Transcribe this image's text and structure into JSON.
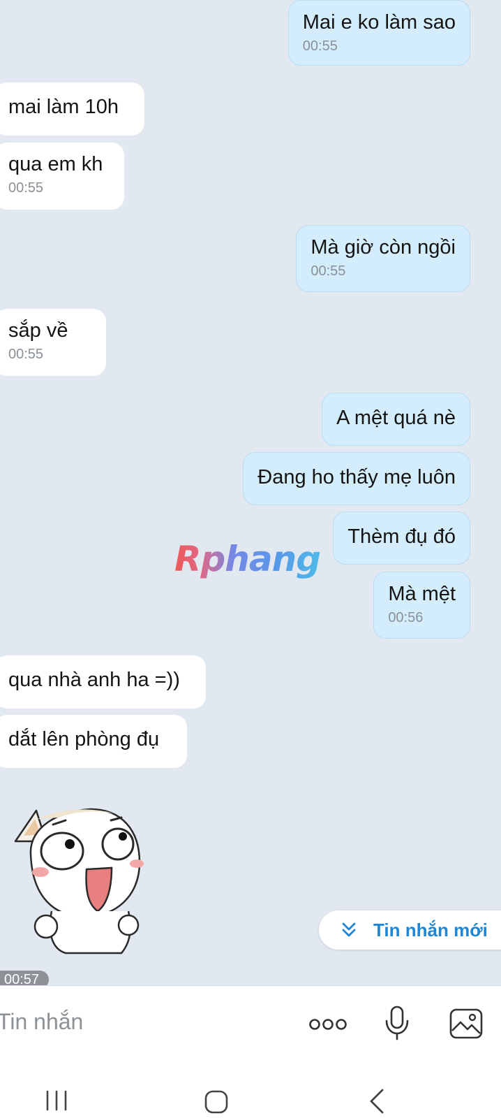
{
  "messages": [
    {
      "text": "Mai e ko làm sao",
      "time": "00:55"
    },
    {
      "text": "mai làm 10h"
    },
    {
      "text": "qua em kh",
      "time": "00:55"
    },
    {
      "text": "Mà giờ còn ngồi",
      "time": "00:55"
    },
    {
      "text": "sắp về",
      "time": "00:55"
    },
    {
      "text": "A mệt quá nè"
    },
    {
      "text": "Đang ho thấy mẹ luôn"
    },
    {
      "text": "Thèm đụ đó"
    },
    {
      "text": "Mà mệt",
      "time": "00:56"
    },
    {
      "text": "qua nhà anh ha =))"
    },
    {
      "text": "dắt lên phòng đụ"
    }
  ],
  "sticker": {
    "time": "00:57"
  },
  "watermark": "Rphang",
  "new_message_button": {
    "label": "Tin nhắn mới"
  },
  "composer": {
    "placeholder": "Tin nhắn"
  },
  "icons": {
    "more": "more-dots-icon",
    "mic": "microphone-icon",
    "gallery": "image-icon",
    "recents": "recent-apps-icon",
    "home": "home-icon",
    "back": "back-icon",
    "new_message": "double-chevron-down-icon"
  },
  "colors": {
    "background": "#e2e8f0",
    "incoming_bubble": "#ffffff",
    "outgoing_bubble": "#d4edfc",
    "accent": "#1f86d6"
  }
}
